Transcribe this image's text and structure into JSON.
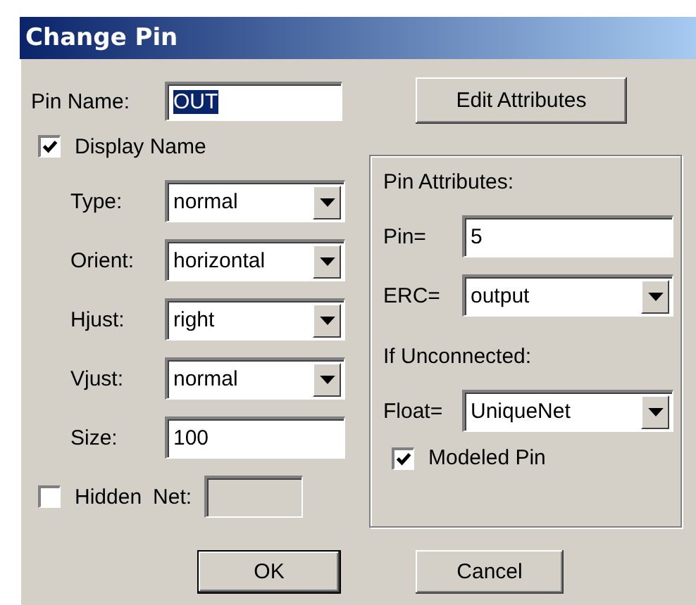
{
  "window": {
    "title": "Change Pin"
  },
  "pin_name": {
    "label": "Pin Name:",
    "value": "OUT",
    "text_selected": true
  },
  "display_name": {
    "label": "Display Name",
    "checked": true
  },
  "fields": [
    {
      "kind": "dropdown",
      "label": "Type:",
      "value": "normal"
    },
    {
      "kind": "dropdown",
      "label": "Orient:",
      "value": "horizontal"
    },
    {
      "kind": "dropdown",
      "label": "Hjust:",
      "value": "right"
    },
    {
      "kind": "dropdown",
      "label": "Vjust:",
      "value": "normal"
    },
    {
      "kind": "text",
      "label": "Size:",
      "value": "100"
    }
  ],
  "hidden": {
    "label": "Hidden",
    "checked": false
  },
  "net": {
    "label": "Net:",
    "disabled": true
  },
  "edit_attributes_button": "Edit Attributes",
  "pin_attributes": {
    "title": "Pin Attributes:",
    "fields": [
      {
        "kind": "text",
        "label": "Pin=",
        "value": "5"
      },
      {
        "kind": "dropdown",
        "label": "ERC=",
        "value": "output"
      }
    ]
  },
  "if_unconnected": {
    "title": "If Unconnected:",
    "fields": [
      {
        "kind": "dropdown",
        "label": "Float=",
        "value": "UniqueNet"
      }
    ],
    "modeled_pin": {
      "label": "Modeled Pin",
      "checked": true
    }
  },
  "buttons": [
    "OK",
    "Cancel"
  ]
}
